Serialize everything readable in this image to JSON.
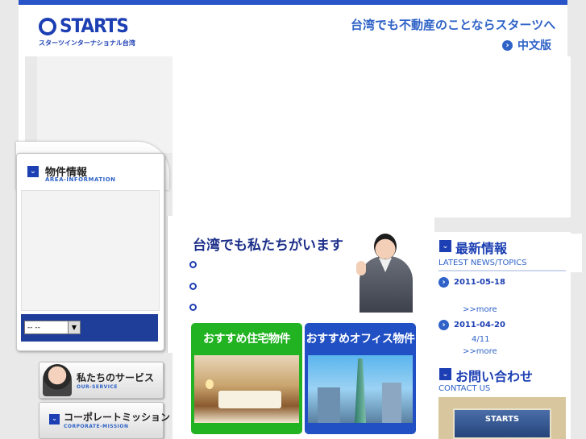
{
  "header": {
    "logo_word": "STARTS",
    "logo_sub": "スターツインターナショナル台湾",
    "tagline": "台湾でも不動産のことならスターツへ",
    "chinese_link": "中文版"
  },
  "area_panel": {
    "title": "物件情報",
    "subtitle": "AREA-INFORMATION",
    "select_value": "-- --"
  },
  "side_buttons": {
    "service_title": "私たちのサービス",
    "service_sub": "OUR-SERVICE",
    "mission_title": "コーポレートミッション",
    "mission_sub": "CORPORATE-MISSION"
  },
  "center": {
    "title": "台湾でも私たちがいます",
    "promo_residential": "おすすめ住宅物件",
    "promo_office": "おすすめオフィス物件"
  },
  "news": {
    "title": "最新情報",
    "subtitle": "LATEST NEWS/TOPICS",
    "items": [
      {
        "date": "2011-05-18",
        "text": "",
        "more": ">>more"
      },
      {
        "date": "2011-04-20",
        "text": "4/11",
        "more": ">>more"
      }
    ]
  },
  "contact": {
    "title": "お問い合わせ",
    "subtitle": "CONTACT US",
    "sign_text": "STARTS"
  },
  "colors": {
    "brand_blue": "#1c3fb3",
    "link_blue": "#2e62c7",
    "promo_green": "#22b322",
    "promo_blue": "#2150c4"
  }
}
